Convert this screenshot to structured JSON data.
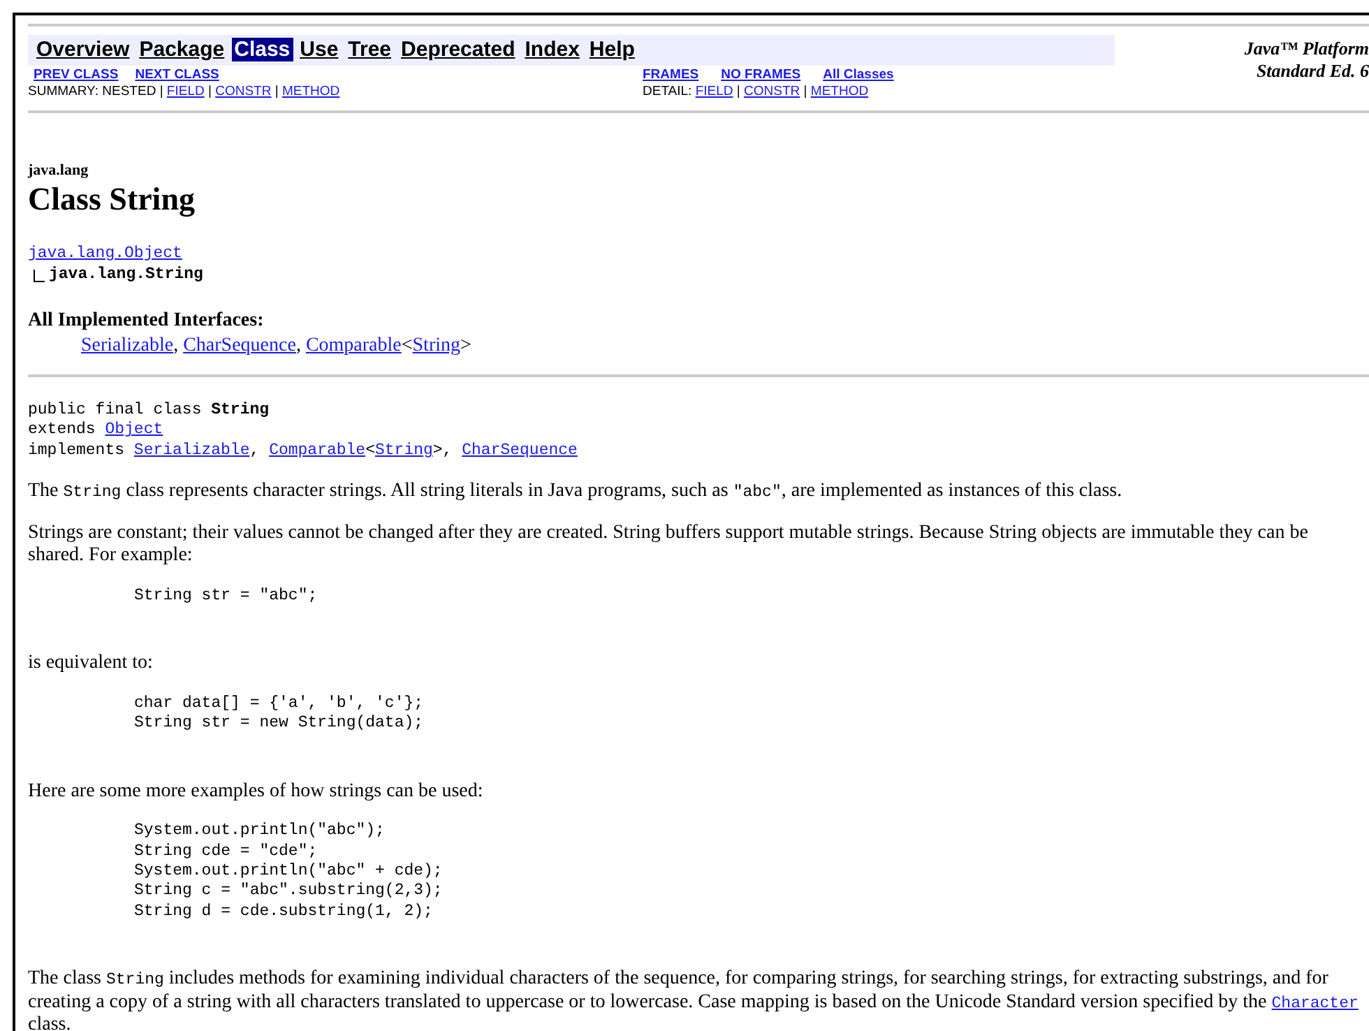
{
  "nav_tabs": [
    {
      "label": "Overview",
      "selected": false
    },
    {
      "label": "Package",
      "selected": false
    },
    {
      "label": "Class",
      "selected": true
    },
    {
      "label": "Use",
      "selected": false
    },
    {
      "label": "Tree",
      "selected": false
    },
    {
      "label": "Deprecated",
      "selected": false
    },
    {
      "label": "Index",
      "selected": false
    },
    {
      "label": "Help",
      "selected": false
    }
  ],
  "platform_title": [
    "Java™ Platform",
    "Standard Ed. 6"
  ],
  "left_links": [
    "PREV CLASS",
    "NEXT CLASS"
  ],
  "right_links": [
    "FRAMES",
    "NO FRAMES",
    "All Classes"
  ],
  "summary_line": [
    {
      "kind": "text",
      "text": "SUMMARY: NESTED | "
    },
    {
      "kind": "link",
      "text": "FIELD"
    },
    {
      "kind": "text",
      "text": " | "
    },
    {
      "kind": "link",
      "text": "CONSTR"
    },
    {
      "kind": "text",
      "text": " | "
    },
    {
      "kind": "link",
      "text": "METHOD"
    }
  ],
  "detail_line": [
    {
      "kind": "text",
      "text": "DETAIL: "
    },
    {
      "kind": "link",
      "text": "FIELD"
    },
    {
      "kind": "text",
      "text": " | "
    },
    {
      "kind": "link",
      "text": "CONSTR"
    },
    {
      "kind": "text",
      "text": " | "
    },
    {
      "kind": "link",
      "text": "METHOD"
    }
  ],
  "package_name": "java.lang",
  "class_title": "Class String",
  "hierarchy": {
    "parent": "java.lang.Object",
    "child": "java.lang.String"
  },
  "interfaces_heading": "All Implemented Interfaces:",
  "interfaces_line": [
    {
      "kind": "link",
      "text": "Serializable"
    },
    {
      "kind": "text",
      "text": ", "
    },
    {
      "kind": "link",
      "text": "CharSequence"
    },
    {
      "kind": "text",
      "text": ", "
    },
    {
      "kind": "link",
      "text": "Comparable"
    },
    {
      "kind": "text",
      "text": "<"
    },
    {
      "kind": "link",
      "text": "String"
    },
    {
      "kind": "text",
      "text": ">"
    }
  ],
  "declaration": [
    [
      {
        "kind": "text",
        "text": "public final class "
      },
      {
        "kind": "bold",
        "text": "String"
      }
    ],
    [
      {
        "kind": "text",
        "text": "extends "
      },
      {
        "kind": "link",
        "text": "Object"
      }
    ],
    [
      {
        "kind": "text",
        "text": "implements "
      },
      {
        "kind": "link",
        "text": "Serializable"
      },
      {
        "kind": "text",
        "text": ", "
      },
      {
        "kind": "link",
        "text": "Comparable"
      },
      {
        "kind": "text",
        "text": "<"
      },
      {
        "kind": "link",
        "text": "String"
      },
      {
        "kind": "text",
        "text": ">, "
      },
      {
        "kind": "link",
        "text": "CharSequence"
      }
    ]
  ],
  "blocks": [
    {
      "kind": "paragraph",
      "segments": [
        {
          "kind": "text",
          "text": "The "
        },
        {
          "kind": "code",
          "text": "String"
        },
        {
          "kind": "text",
          "text": " class represents character strings. All string literals in Java programs, such as "
        },
        {
          "kind": "code",
          "text": "\"abc\""
        },
        {
          "kind": "text",
          "text": ", are implemented as instances of this class."
        }
      ]
    },
    {
      "kind": "paragraph",
      "segments": [
        {
          "kind": "text",
          "text": "Strings are constant; their values cannot be changed after they are created. String buffers support mutable strings. Because String objects are immutable they can be shared. For example:"
        }
      ]
    },
    {
      "kind": "code",
      "lines": [
        "String str = \"abc\";"
      ]
    },
    {
      "kind": "paragraph",
      "segments": [
        {
          "kind": "text",
          "text": "is equivalent to:"
        }
      ]
    },
    {
      "kind": "code",
      "lines": [
        "char data[] = {'a', 'b', 'c'};",
        "String str = new String(data);"
      ]
    },
    {
      "kind": "paragraph",
      "segments": [
        {
          "kind": "text",
          "text": "Here are some more examples of how strings can be used:"
        }
      ]
    },
    {
      "kind": "code",
      "lines": [
        "System.out.println(\"abc\");",
        "String cde = \"cde\";",
        "System.out.println(\"abc\" + cde);",
        "String c = \"abc\".substring(2,3);",
        "String d = cde.substring(1, 2);"
      ]
    },
    {
      "kind": "paragraph",
      "segments": [
        {
          "kind": "text",
          "text": "The class "
        },
        {
          "kind": "code",
          "text": "String"
        },
        {
          "kind": "text",
          "text": " includes methods for examining individual characters of the sequence, for comparing strings, for searching strings, for extracting substrings, and for creating a copy of a string with all characters translated to uppercase or to lowercase. Case mapping is based on the Unicode Standard version specified by the "
        },
        {
          "kind": "code-link",
          "text": "Character"
        },
        {
          "kind": "text",
          "text": " class."
        }
      ]
    }
  ]
}
